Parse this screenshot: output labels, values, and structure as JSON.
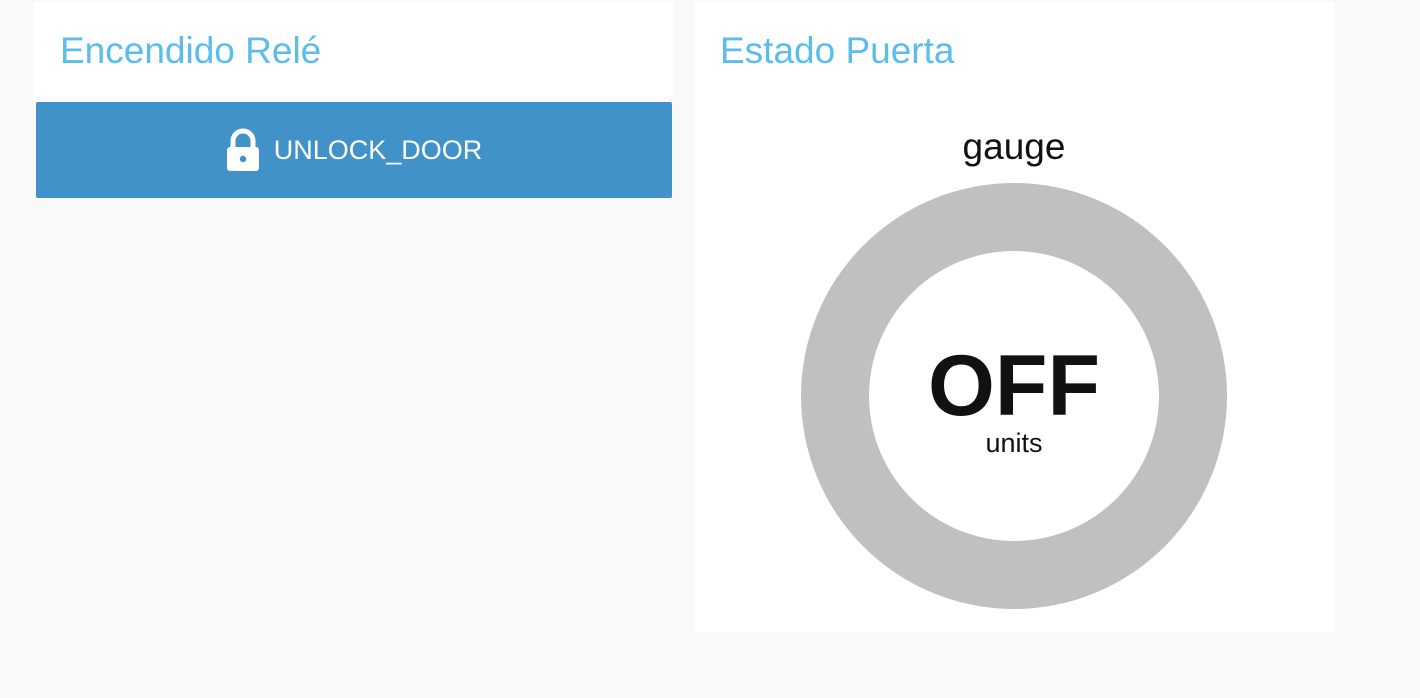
{
  "theme": {
    "title_color": "#5bbcee",
    "button_color": "#4192c9",
    "gauge_track_color": "#c0c0c0",
    "gauge_center_color": "#ffffff",
    "gauge_text_color": "#111111"
  },
  "relay_card": {
    "title": "Encendido Relé",
    "button": {
      "label": "UNLOCK_DOOR",
      "icon": "lock-icon"
    }
  },
  "door_card": {
    "title": "Estado Puerta",
    "gauge": {
      "title": "gauge",
      "value": "OFF",
      "units": "units"
    }
  }
}
